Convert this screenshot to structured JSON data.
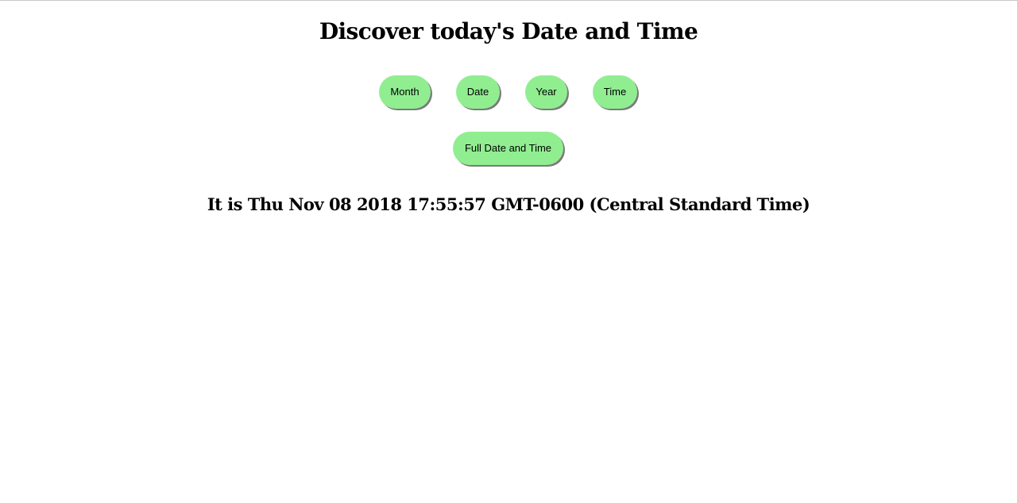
{
  "header": {
    "title": "Discover today's Date and Time"
  },
  "buttons": {
    "month": "Month",
    "date": "Date",
    "year": "Year",
    "time": "Time",
    "full": "Full Date and Time"
  },
  "result": {
    "text": "It is Thu Nov 08 2018 17:55:57 GMT-0600 (Central Standard Time)"
  },
  "colors": {
    "button_background": "#90ee90",
    "button_shadow": "#7a7a7a",
    "text": "#000000",
    "page_background": "#ffffff"
  }
}
